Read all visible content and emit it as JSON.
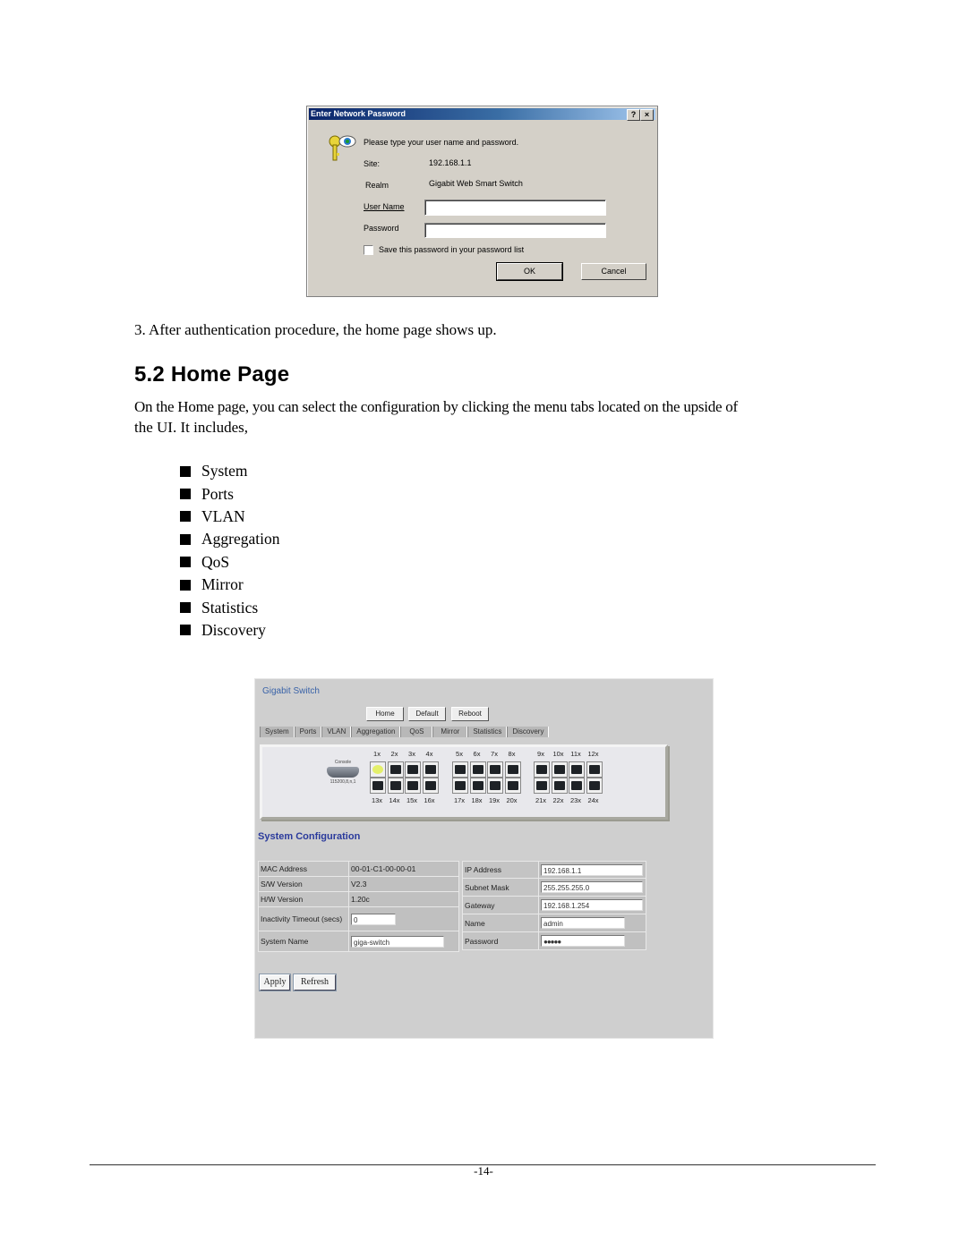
{
  "dialog": {
    "title": "Enter Network Password",
    "help_button": "?",
    "close_button": "×",
    "prompt": "Please type your user name and password.",
    "site_label": "Site:",
    "site_value": "192.168.1.1",
    "realm_label": "Realm",
    "realm_value": "Gigabit Web Smart Switch",
    "username_label": "User Name",
    "username_value": "",
    "password_label": "Password",
    "password_value": "",
    "save_password_label": "Save this password in your password list",
    "save_password_checked": false,
    "ok_label": "OK",
    "cancel_label": "Cancel"
  },
  "step_text": "3.  After authentication procedure, the home page shows up.",
  "section_heading": "5.2 Home Page",
  "intro_line1": "On the Home page, you can select the configuration by clicking the menu tabs located on the upside of",
  "intro_line2": "the UI. It includes,",
  "menu_items": [
    "System",
    "Ports",
    "VLAN",
    "Aggregation",
    "QoS",
    "Mirror",
    "Statistics",
    "Discovery"
  ],
  "switch_ui": {
    "title": "Gigabit Switch",
    "buttons": {
      "home": "Home",
      "default": "Default",
      "reboot": "Reboot"
    },
    "tabs": [
      "System",
      "Ports",
      "VLAN",
      "Aggregation",
      "QoS",
      "Mirror",
      "Statistics",
      "Discovery"
    ],
    "console_label": "Console",
    "console_sub": "115200,8,n,1",
    "ports_top": [
      "1x",
      "2x",
      "3x",
      "4x",
      "5x",
      "6x",
      "7x",
      "8x",
      "9x",
      "10x",
      "11x",
      "12x"
    ],
    "ports_bottom": [
      "13x",
      "14x",
      "15x",
      "16x",
      "17x",
      "18x",
      "19x",
      "20x",
      "21x",
      "22x",
      "23x",
      "24x"
    ],
    "active_ports": [
      "1x"
    ],
    "active_color": "#e4f06a",
    "section_title": "System Configuration",
    "left_table": {
      "mac_label": "MAC Address",
      "mac_value": "00-01-C1-00-00-01",
      "sw_label": "S/W Version",
      "sw_value": "V2.3",
      "hw_label": "H/W Version",
      "hw_value": "1.20c",
      "timeout_label": "Inactivity Timeout (secs)",
      "timeout_value": "0",
      "sysname_label": "System Name",
      "sysname_value": "giga-switch"
    },
    "right_table": {
      "ip_label": "IP Address",
      "ip_value": "192.168.1.1",
      "mask_label": "Subnet Mask",
      "mask_value": "255.255.255.0",
      "gw_label": "Gateway",
      "gw_value": "192.168.1.254",
      "name_label": "Name",
      "name_value": "admin",
      "pw_label": "Password",
      "pw_value": "●●●●●"
    },
    "apply_label": "Apply",
    "refresh_label": "Refresh"
  },
  "page_number": "-14-"
}
